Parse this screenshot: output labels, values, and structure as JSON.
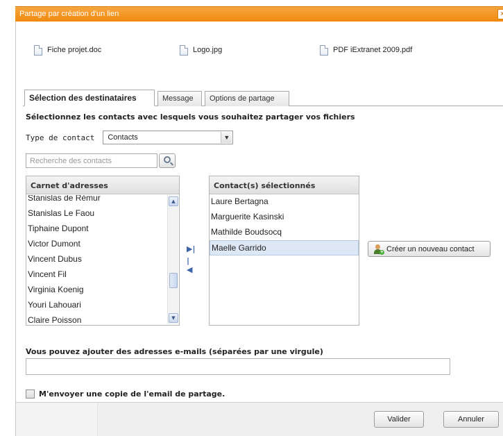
{
  "dialog": {
    "title": "Partage par création d'un lien",
    "close_symbol": "x"
  },
  "files": [
    "Fiche projet.doc",
    "Logo.jpg",
    "PDF iExtranet 2009.pdf"
  ],
  "tabs": [
    "Sélection des destinataires",
    "Message",
    "Options de partage"
  ],
  "instruction": "Sélectionnez les contacts avec lesquels vous souhaitez partager vos fichiers",
  "contact_type": {
    "label": "Type de contact",
    "value": "Contacts"
  },
  "search": {
    "placeholder": "Recherche des contacts"
  },
  "address_book": {
    "header": "Carnet d'adresses",
    "items": [
      "Stanislas de Rémur",
      "Stanislas Le Faou",
      "Tiphaine Dupont",
      "Victor Dumont",
      "Vincent Dubus",
      "Vincent Fil",
      "Virginia Koenig",
      "Youri Lahouari",
      "Claire Poisson"
    ]
  },
  "selected_contacts": {
    "header": "Contact(s) sélectionnés",
    "items": [
      "Laure Bertagna",
      "Marguerite Kasinski",
      "Mathilde Boudsocq",
      "Maelle Garrido"
    ],
    "highlighted_index": 3
  },
  "mover_icons": {
    "add": "▶|",
    "remove": "|◀"
  },
  "new_contact_button": "Créer un nouveau contact",
  "email_section": {
    "label": "Vous pouvez ajouter des adresses e-mails (séparées par une virgule)",
    "value": ""
  },
  "copy_checkbox": {
    "label": "M'envoyer une copie de l'email de partage.",
    "checked": false
  },
  "buttons": {
    "validate": "Valider",
    "cancel": "Annuler"
  },
  "colors": {
    "title_bar": "#f08a0e",
    "selection": "#dde7f5"
  }
}
